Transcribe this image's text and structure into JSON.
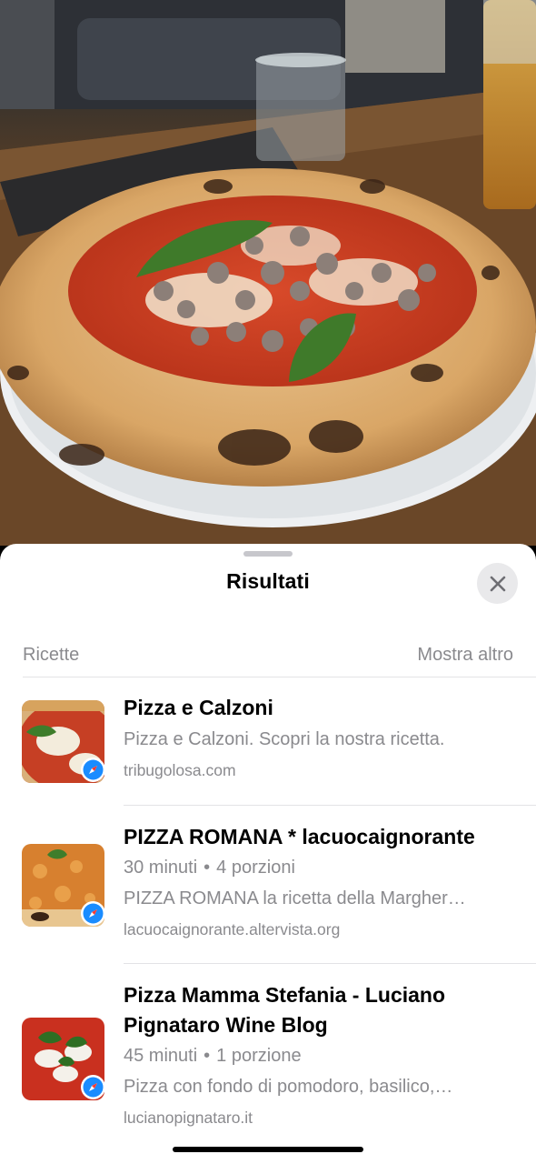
{
  "photo": {
    "subject": "pizza-photo"
  },
  "sheet": {
    "title": "Risultati",
    "close_icon": "xmark-icon"
  },
  "section": {
    "label": "Ricette",
    "more_label": "Mostra altro"
  },
  "results": [
    {
      "title": "Pizza e Calzoni",
      "meta_time": "",
      "meta_portions": "",
      "description": "Pizza e Calzoni. Scopri la nostra ricetta.",
      "source": "tribugolosa.com",
      "badge_icon": "safari-icon"
    },
    {
      "title": "PIZZA ROMANA * lacuocaignorante",
      "meta_time": "30 minuti",
      "meta_portions": "4 porzioni",
      "description": "PIZZA ROMANA la ricetta della Margher…",
      "source": "lacuocaignorante.altervista.org",
      "badge_icon": "safari-icon"
    },
    {
      "title_line1": "Pizza Mamma Stefania - Luciano",
      "title_line2": "Pignataro Wine Blog",
      "meta_time": "45 minuti",
      "meta_portions": "1 porzione",
      "description": "Pizza con fondo di pomodoro, basilico,…",
      "source": "lucianopignataro.it",
      "badge_icon": "safari-icon"
    }
  ],
  "colors": {
    "sheet_bg": "#ffffff",
    "secondary_text": "#8a8a8e",
    "divider": "#e3e3e6",
    "safari_blue": "#1a8cff"
  }
}
